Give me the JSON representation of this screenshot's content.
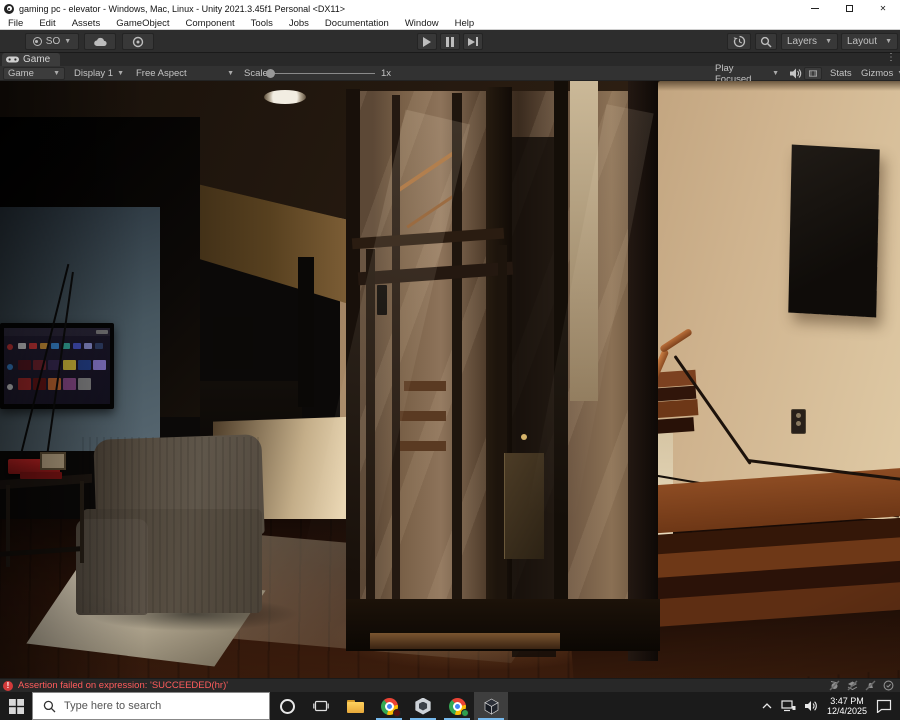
{
  "window": {
    "title": "gaming pc - elevator - Windows, Mac, Linux - Unity 2021.3.45f1 Personal <DX11>"
  },
  "menus": [
    "File",
    "Edit",
    "Assets",
    "GameObject",
    "Component",
    "Tools",
    "Jobs",
    "Documentation",
    "Window",
    "Help"
  ],
  "toolbar": {
    "account": "SO",
    "layers": "Layers",
    "layout": "Layout"
  },
  "tab": {
    "label": "Game"
  },
  "gt": {
    "mode": "Game",
    "display": "Display 1",
    "aspect": "Free Aspect",
    "scaleLabel": "Scale",
    "scaleValue": "1x",
    "playFocused": "Play Focused",
    "stats": "Stats",
    "gizmos": "Gizmos"
  },
  "status": {
    "error": "Assertion failed on expression: 'SUCCEEDED(hr)'"
  },
  "taskbar": {
    "searchPlaceholder": "Type here to search",
    "clockTime": "3:47 PM",
    "clockDate": "12/4/2025"
  },
  "colors": {
    "errorRed": "#ff5c5c",
    "runningUnderline": "#76b9ed",
    "chromeBadgeDark": "#5a0f0f",
    "chromeBadgeGreen": "#2e9e4f"
  },
  "scene": {
    "tv": {
      "navCircles": [
        "#e23b3b",
        "#3b8fe2",
        "#e8e8e8"
      ],
      "appRow": [
        "#e8e8e8",
        "#e23b3b",
        "#e2a13b",
        "#3b8fe2",
        "#35b5a5",
        "#4655c8",
        "#8a8fd0",
        "#2f3f66"
      ],
      "thumbRow1": [
        "#5a1620",
        "#7a2430",
        "#3a2a55",
        "#d8c23a",
        "#23408a",
        "#8a7ad0"
      ],
      "thumbRow2": [
        "#b02a2a",
        "#6a1515",
        "#c86a30",
        "#8a4a8a",
        "#888888"
      ]
    }
  }
}
